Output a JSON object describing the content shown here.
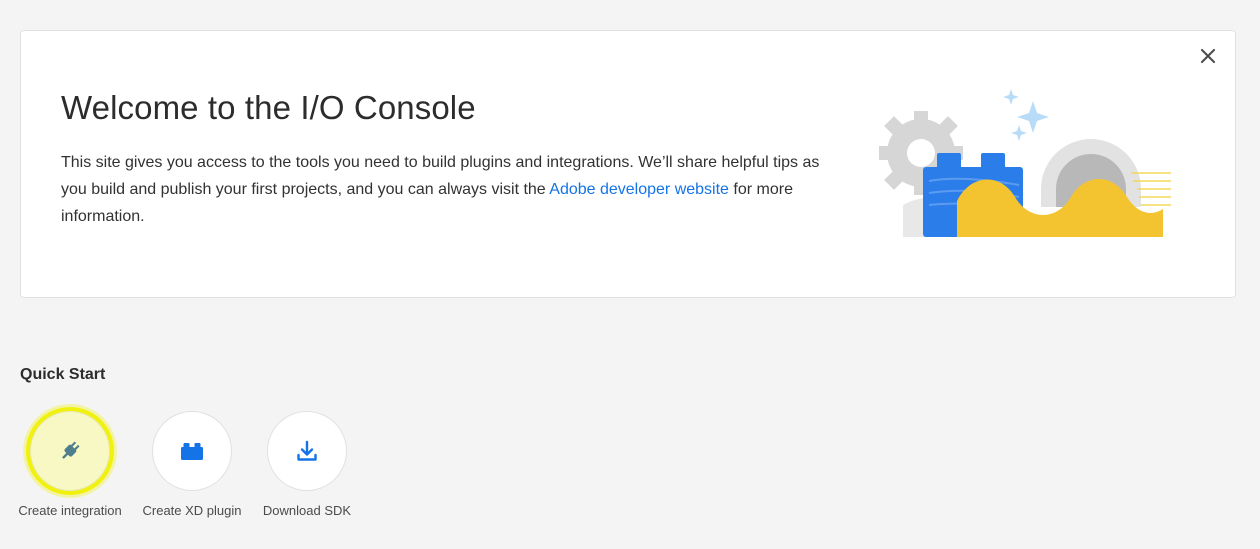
{
  "welcome": {
    "title": "Welcome to the I/O Console",
    "body_pre": "This site gives you access to the tools you need to build plugins and integrations. We’ll share helpful tips as you build and publish your first projects, and you can always visit the ",
    "link_text": "Adobe developer website",
    "body_post": " for more information.",
    "close_icon": "close-icon"
  },
  "quick_start": {
    "title": "Quick Start",
    "items": [
      {
        "label": "Create integration",
        "icon": "plug-icon",
        "highlighted": true
      },
      {
        "label": "Create XD plugin",
        "icon": "plugin-block-icon",
        "highlighted": false
      },
      {
        "label": "Download SDK",
        "icon": "download-icon",
        "highlighted": false
      }
    ]
  },
  "colors": {
    "link": "#1473e6",
    "accent_blue": "#1473e6",
    "highlight_ring": "#f1f10f",
    "page_bg": "#f4f4f4"
  }
}
